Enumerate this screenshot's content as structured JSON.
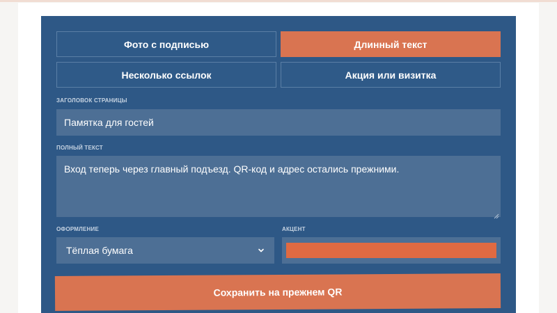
{
  "tabs": [
    {
      "label": "Фото с подписью",
      "active": false
    },
    {
      "label": "Длинный текст",
      "active": true
    },
    {
      "label": "Несколько ссылок",
      "active": false
    },
    {
      "label": "Акция или визитка",
      "active": false
    }
  ],
  "form": {
    "title_label": "ЗАГОЛОВОК СТРАНИЦЫ",
    "title_value": "Памятка для гостей",
    "text_label": "ПОЛНЫЙ ТЕКСТ",
    "text_value": "Вход теперь через главный подъезд. QR-код и адрес остались прежними.",
    "style_label": "ОФОРМЛЕНИЕ",
    "style_value": "Тёплая бумага",
    "accent_label": "АКЦЕНТ",
    "accent_color": "#e06a42"
  },
  "actions": {
    "save_label": "Сохранить на прежнем QR"
  },
  "colors": {
    "panel": "#2e5886",
    "field": "#4d6f95",
    "accent": "#d97451"
  },
  "icons": {
    "select_chevron": "chevron-down-icon",
    "textarea_grip": "resize-grip-icon"
  }
}
